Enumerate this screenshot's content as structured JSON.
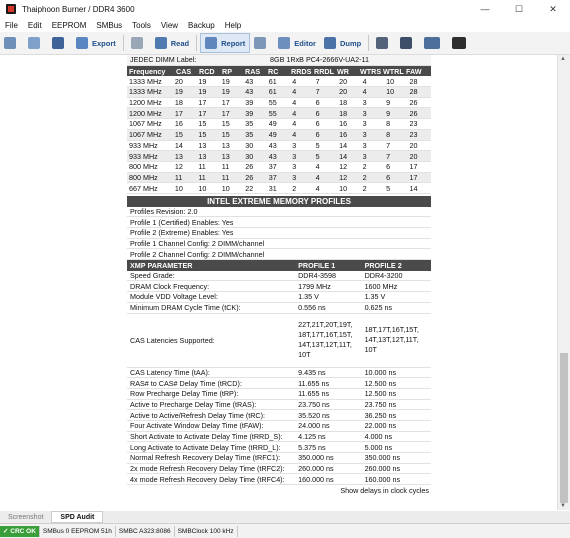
{
  "window": {
    "title": "Thaiphoon Burner / DDR4 3600",
    "controls": [
      "—",
      "☐",
      "✕"
    ]
  },
  "menu": [
    "File",
    "Edit",
    "EEPROM",
    "SMBus",
    "Tools",
    "View",
    "Backup",
    "Help"
  ],
  "toolbar": {
    "export": "Export",
    "read": "Read",
    "report": "Report",
    "editor": "Editor",
    "dump": "Dump"
  },
  "jedec": {
    "label": "JEDEC DIMM Label:",
    "value": "8GB 1RxB PC4-2666V-UA2-11"
  },
  "timing_headers": [
    "Frequency",
    "CAS",
    "RCD",
    "RP",
    "RAS",
    "RC",
    "RRDS",
    "RRDL",
    "WR",
    "WTRS",
    "WTRL",
    "FAW"
  ],
  "timing_rows": [
    [
      "1333 MHz",
      "20",
      "19",
      "19",
      "43",
      "61",
      "4",
      "7",
      "20",
      "4",
      "10",
      "28"
    ],
    [
      "1333 MHz",
      "19",
      "19",
      "19",
      "43",
      "61",
      "4",
      "7",
      "20",
      "4",
      "10",
      "28"
    ],
    [
      "1200 MHz",
      "18",
      "17",
      "17",
      "39",
      "55",
      "4",
      "6",
      "18",
      "3",
      "9",
      "26"
    ],
    [
      "1200 MHz",
      "17",
      "17",
      "17",
      "39",
      "55",
      "4",
      "6",
      "18",
      "3",
      "9",
      "26"
    ],
    [
      "1067 MHz",
      "16",
      "15",
      "15",
      "35",
      "49",
      "4",
      "6",
      "16",
      "3",
      "8",
      "23"
    ],
    [
      "1067 MHz",
      "15",
      "15",
      "15",
      "35",
      "49",
      "4",
      "6",
      "16",
      "3",
      "8",
      "23"
    ],
    [
      "933 MHz",
      "14",
      "13",
      "13",
      "30",
      "43",
      "3",
      "5",
      "14",
      "3",
      "7",
      "20"
    ],
    [
      "933 MHz",
      "13",
      "13",
      "13",
      "30",
      "43",
      "3",
      "5",
      "14",
      "3",
      "7",
      "20"
    ],
    [
      "800 MHz",
      "12",
      "11",
      "11",
      "26",
      "37",
      "3",
      "4",
      "12",
      "2",
      "6",
      "17"
    ],
    [
      "800 MHz",
      "11",
      "11",
      "11",
      "26",
      "37",
      "3",
      "4",
      "12",
      "2",
      "6",
      "17"
    ],
    [
      "667 MHz",
      "10",
      "10",
      "10",
      "22",
      "31",
      "2",
      "4",
      "10",
      "2",
      "5",
      "14"
    ]
  ],
  "xmp_section": "INTEL EXTREME MEMORY PROFILES",
  "xmp_info": [
    "Profiles Revision: 2.0",
    "Profile 1 (Certified) Enables: Yes",
    "Profile 2 (Extreme) Enables: Yes",
    "Profile 1 Channel Config: 2 DIMM/channel",
    "Profile 2 Channel Config: 2 DIMM/channel"
  ],
  "xmp_headers": [
    "XMP PARAMETER",
    "PROFILE 1",
    "PROFILE 2"
  ],
  "xmp_rows": [
    [
      "Speed Grade:",
      "DDR4-3598",
      "DDR4-3200"
    ],
    [
      "DRAM Clock Frequency:",
      "1799 MHz",
      "1600 MHz"
    ],
    [
      "Module VDD Voltage Level:",
      "1.35 V",
      "1.35 V"
    ],
    [
      "Minimum DRAM Cycle Time (tCK):",
      "0.556 ns",
      "0.625 ns"
    ]
  ],
  "xmp_cas": {
    "label": "CAS Latencies Supported:",
    "p1": "22T,21T,20T,19T, 18T,17T,16T,15T, 14T,13T,12T,11T, 10T",
    "p2": "18T,17T,16T,15T, 14T,13T,12T,11T, 10T"
  },
  "xmp_rows2": [
    [
      "CAS Latency Time (tAA):",
      "9.435 ns",
      "10.000 ns"
    ],
    [
      "RAS# to CAS# Delay Time (tRCD):",
      "11.655 ns",
      "12.500 ns"
    ],
    [
      "Row Precharge Delay Time (tRP):",
      "11.655 ns",
      "12.500 ns"
    ],
    [
      "Active to Precharge Delay Time (tRAS):",
      "23.750 ns",
      "23.750 ns"
    ],
    [
      "Active to Active/Refresh Delay Time (tRC):",
      "35.520 ns",
      "36.250 ns"
    ],
    [
      "Four Activate Window Delay Time (tFAW):",
      "24.000 ns",
      "22.000 ns"
    ],
    [
      "Short Activate to Activate Delay Time (tRRD_S):",
      "4.125 ns",
      "4.000 ns"
    ],
    [
      "Long Activate to Activate Delay Time (tRRD_L):",
      "5.375 ns",
      "5.000 ns"
    ],
    [
      "Normal Refresh Recovery Delay Time (tRFC1):",
      "350.000 ns",
      "350.000 ns"
    ],
    [
      "2x mode Refresh Recovery Delay Time (tRFC2):",
      "260.000 ns",
      "260.000 ns"
    ],
    [
      "4x mode Refresh Recovery Delay Time (tRFC4):",
      "160.000 ns",
      "160.000 ns"
    ]
  ],
  "footer_text": "Show delays in clock cycles",
  "bottom_tabs": [
    "Screenshot",
    "SPD Audit"
  ],
  "status": [
    "✓ CRC OK",
    "SMBus 0 EEPROM 51h",
    "SMBC A323:8086",
    "SMBClock 100 kHz"
  ]
}
